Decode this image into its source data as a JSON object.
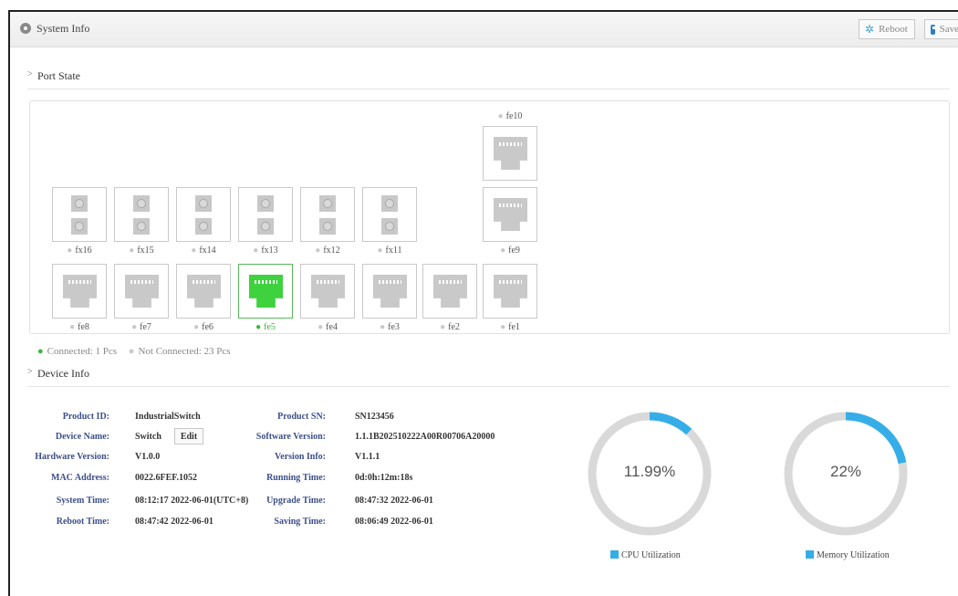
{
  "header": {
    "title": "System Info",
    "reboot_label": "Reboot",
    "save_label": "Save"
  },
  "port_state": {
    "heading": "Port State",
    "top_port": "fe10",
    "mid_port": "fe9",
    "fiber_ports": [
      "fx16",
      "fx15",
      "fx14",
      "fx13",
      "fx12",
      "fx11"
    ],
    "bottom_ports": [
      "fe8",
      "fe7",
      "fe6",
      "fe5",
      "fe4",
      "fe3",
      "fe2",
      "fe1"
    ],
    "connected_ports": [
      "fe5"
    ],
    "legend_connected": "Connected: 1 Pcs",
    "legend_not_connected": "Not Connected: 23 Pcs"
  },
  "device_info": {
    "heading": "Device Info",
    "edit_label": "Edit",
    "left": [
      {
        "label": "Product ID:",
        "value": "IndustrialSwitch"
      },
      {
        "label": "Device Name:",
        "value": "Switch"
      },
      {
        "label": "Hardware Version:",
        "value": "V1.0.0"
      },
      {
        "label": "MAC Address:",
        "value": "0022.6FEF.1052"
      },
      {
        "label": "System Time:",
        "value": "08:12:17 2022-06-01(UTC+8)"
      },
      {
        "label": "Reboot Time:",
        "value": "08:47:42 2022-06-01"
      }
    ],
    "right": [
      {
        "label": "Product SN:",
        "value": "SN123456"
      },
      {
        "label": "Software Version:",
        "value": "1.1.1B202510222A00R00706A20000"
      },
      {
        "label": "Version Info:",
        "value": "V1.1.1"
      },
      {
        "label": "Running Time:",
        "value": "0d:0h:12m:18s"
      },
      {
        "label": "Upgrade Time:",
        "value": "08:47:32 2022-06-01"
      },
      {
        "label": "Saving Time:",
        "value": "08:06:49 2022-06-01"
      }
    ]
  },
  "gauges": {
    "cpu": {
      "text": "11.99%",
      "fraction": 0.1199,
      "legend": "CPU Utilization"
    },
    "memory": {
      "text": "22%",
      "fraction": 0.22,
      "legend": "Memory Utilization"
    },
    "track_color": "#d9d9d9",
    "fill_color": "#35aee8"
  },
  "colors": {
    "connected": "#3fd23f",
    "port_idle": "#c9c9c9",
    "label_blue": "#3c4f8a"
  }
}
